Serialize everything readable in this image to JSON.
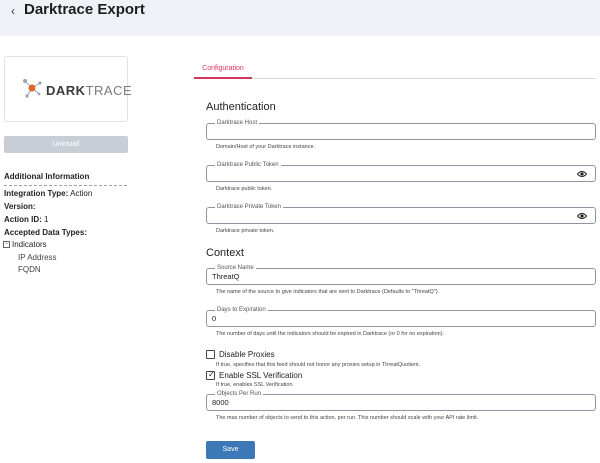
{
  "header": {
    "title": "Darktrace Export"
  },
  "sidebar": {
    "logo": {
      "dark": "DARK",
      "trace": "TRACE"
    },
    "uninstall_label": "Uninstall",
    "additional_info_title": "Additional Information",
    "integration_type_label": "Integration Type:",
    "integration_type_value": "Action",
    "version_label": "Version:",
    "action_id_label": "Action ID:",
    "action_id_value": "1",
    "accepted_data_types_label": "Accepted Data Types:",
    "tree": {
      "toggle": "−",
      "label": "Indicators",
      "children": [
        "IP Address",
        "FQDN"
      ]
    }
  },
  "tabs": [
    {
      "label": "Configuration"
    }
  ],
  "form": {
    "authentication_title": "Authentication",
    "host": {
      "label": "Darktrace Host",
      "value": "",
      "hint": "Domain/Host of your Darktrace instance."
    },
    "public_token": {
      "label": "Darktrace Public Token",
      "value": "",
      "hint": "Darktrace public token."
    },
    "private_token": {
      "label": "Darktrace Private Token",
      "value": "",
      "hint": "Darktrace private token."
    },
    "context_title": "Context",
    "source_name": {
      "label": "Source Name",
      "value": "ThreatQ",
      "hint": "The name of the source to give indicators that are sent to Darktrace (Defaults to \"ThreatQ\")."
    },
    "days_to_expiration": {
      "label": "Days to Expiration",
      "value": "0",
      "hint": "The number of days until the indicators should be expired in Darktrace (or 0 for no expiration)."
    },
    "disable_proxies": {
      "label": "Disable Proxies",
      "checked": false,
      "hint": "If true, specifies that this feed should not honor any proxies setup in ThreatQuotient."
    },
    "enable_ssl": {
      "label": "Enable SSL Verification",
      "checked": true,
      "hint": "If true, enables SSL Verification"
    },
    "objects_per_run": {
      "label": "Objects Per Run",
      "value": "8000",
      "hint": "The max number of objects to send to this action, per run. This number should scale with your API rate limit."
    },
    "save_label": "Save"
  },
  "colors": {
    "accent": "#d6365f",
    "primary_button": "#3c78b5",
    "header_bg": "#eef2f7"
  }
}
